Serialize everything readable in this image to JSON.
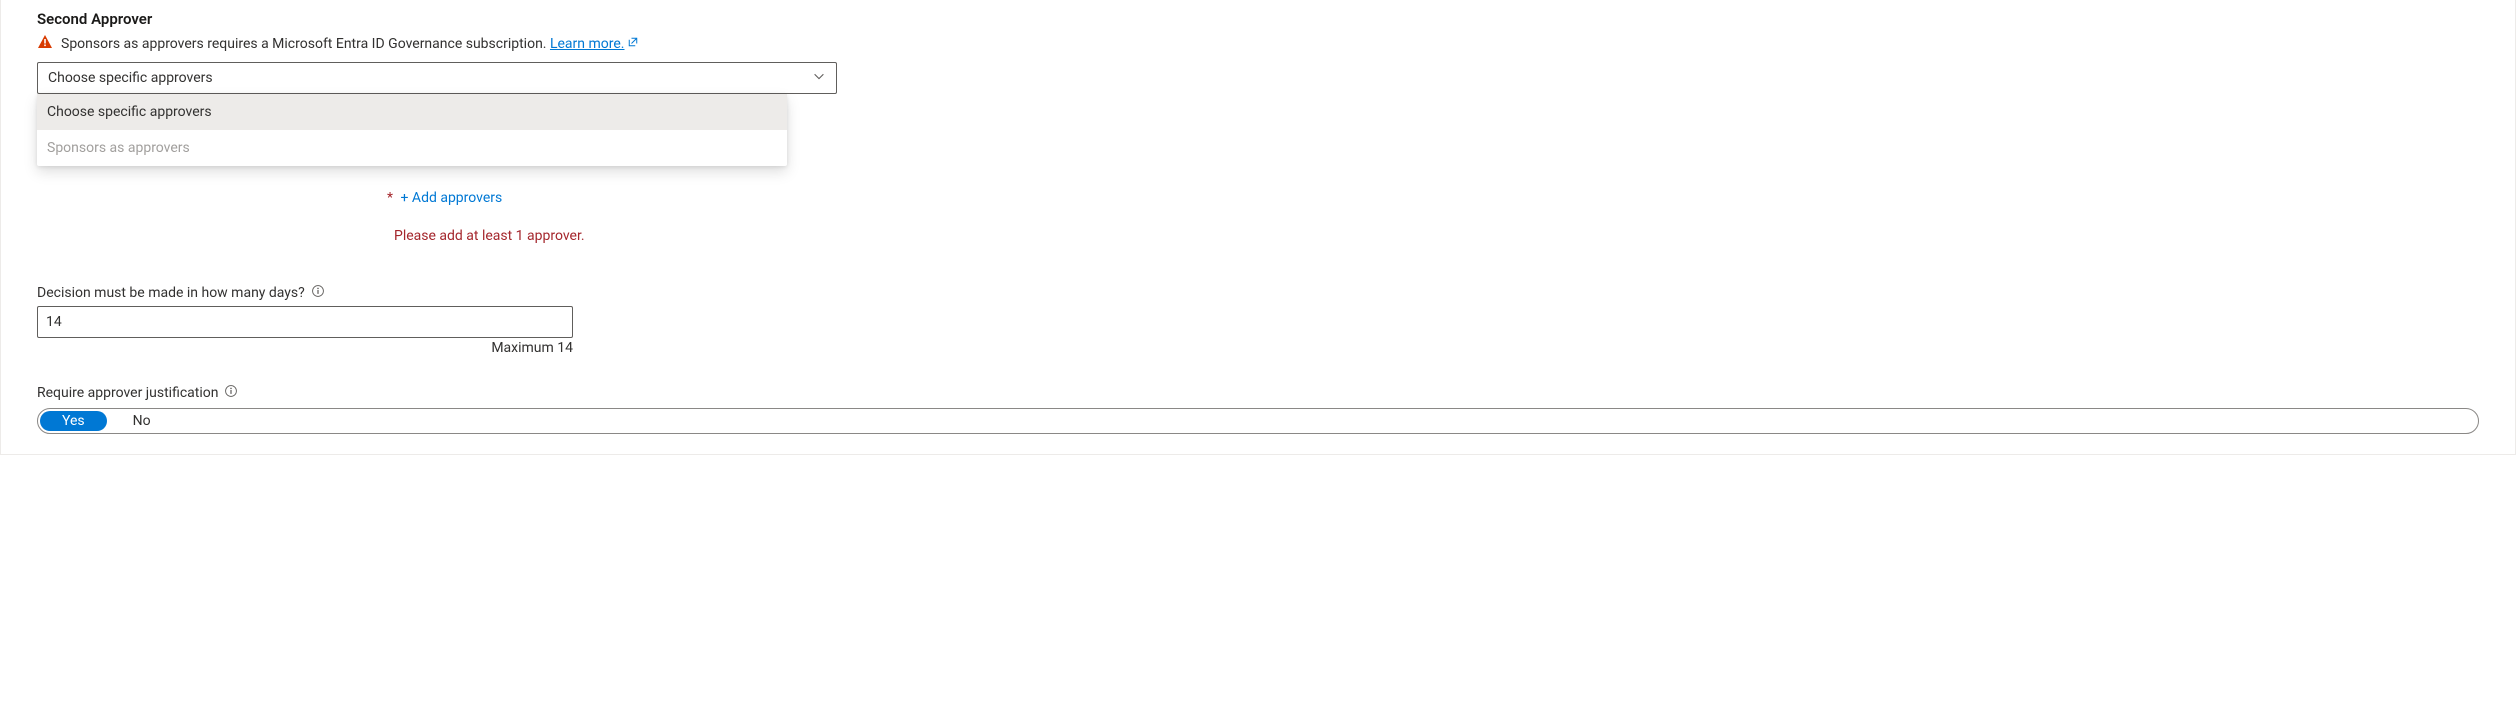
{
  "heading": "Second Approver",
  "warning": {
    "text": "Sponsors as approvers requires a Microsoft Entra ID Governance subscription. ",
    "link_label": "Learn more."
  },
  "dropdown": {
    "selected": "Choose specific approvers",
    "options": [
      {
        "label": "Choose specific approvers",
        "selected": true,
        "disabled": false
      },
      {
        "label": "Sponsors as approvers",
        "selected": false,
        "disabled": true
      }
    ]
  },
  "add_approvers": {
    "star": "*",
    "label": "+ Add approvers"
  },
  "error": "Please add at least 1 approver.",
  "decision_days": {
    "label": "Decision must be made in how many days?",
    "value": "14",
    "helper": "Maximum 14"
  },
  "justification": {
    "label": "Require approver justification",
    "yes": "Yes",
    "no": "No"
  }
}
